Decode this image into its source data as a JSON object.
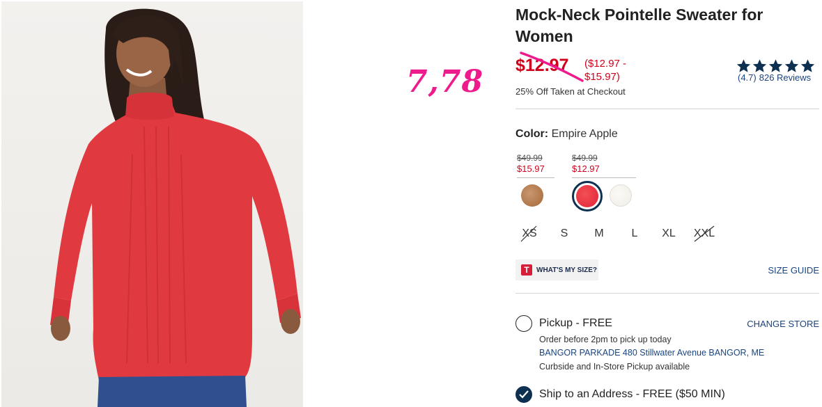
{
  "annotation": {
    "handwritten_price": "7,78",
    "color": "#ee1b8c"
  },
  "product": {
    "title": "Mock-Neck Pointelle Sweater for Women",
    "sale_price": "$12.97",
    "price_range": "($12.97 - $15.97)",
    "promo_text": "25% Off Taken at Checkout",
    "rating_stars": 5,
    "rating_text": "(4.7)",
    "reviews_text": "826 Reviews"
  },
  "color_selector": {
    "label": "Color:",
    "selected": "Empire Apple",
    "price_groups": [
      {
        "was": "$49.99",
        "now": "$15.97"
      },
      {
        "was": "$49.99",
        "now": "$12.97"
      }
    ],
    "swatches": [
      {
        "name": "tan",
        "color": "#b07648",
        "selected": false
      },
      {
        "name": "empire-apple",
        "color": "#e63040",
        "selected": true
      },
      {
        "name": "cream",
        "color": "#f3f1eb",
        "selected": false
      }
    ]
  },
  "sizes": [
    {
      "label": "XS",
      "available": false
    },
    {
      "label": "S",
      "available": true
    },
    {
      "label": "M",
      "available": true
    },
    {
      "label": "L",
      "available": true
    },
    {
      "label": "XL",
      "available": true
    },
    {
      "label": "XXL",
      "available": false
    }
  ],
  "size_help": {
    "whats_my_size": "WHAT'S MY SIZE?",
    "size_guide": "SIZE GUIDE"
  },
  "fulfillment": {
    "pickup": {
      "title": "Pickup - FREE",
      "change_store": "CHANGE STORE",
      "line1": "Order before 2pm to pick up today",
      "address": "BANGOR PARKADE 480 Stillwater Avenue  BANGOR, ME",
      "line3": "Curbside and In-Store Pickup available",
      "selected": false
    },
    "ship": {
      "title": "Ship to an Address - FREE ($50 MIN)",
      "selected": true
    }
  },
  "colors": {
    "sale_red": "#d0021b",
    "link_blue": "#1a4480",
    "navy": "#0e3050"
  }
}
